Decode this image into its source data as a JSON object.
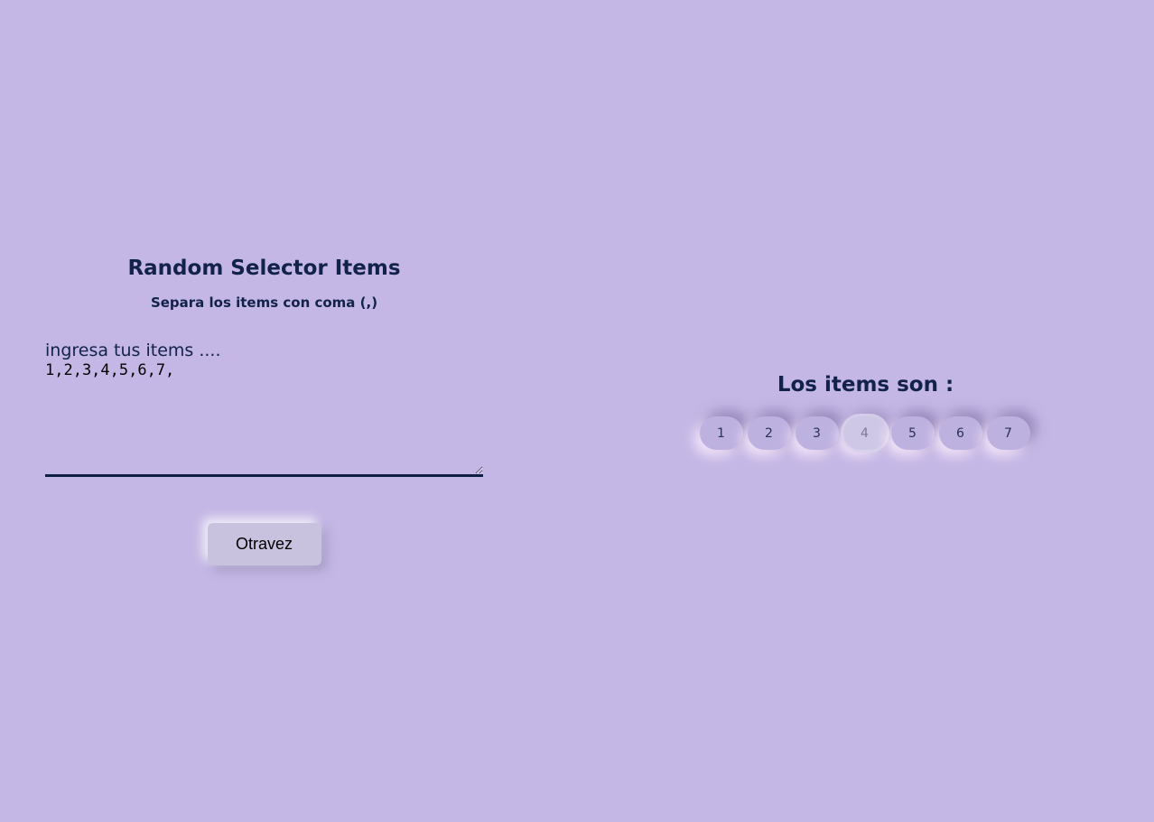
{
  "app": {
    "title": "Random Selector Items",
    "subtitle": "Separa los items con coma (,)"
  },
  "input": {
    "label": "ingresa tus items ....",
    "value": "1,2,3,4,5,6,7,"
  },
  "button": {
    "label": "Otravez"
  },
  "results": {
    "title": "Los items son :",
    "items": [
      "1",
      "2",
      "3",
      "4",
      "5",
      "6",
      "7"
    ],
    "selected": "4"
  },
  "colors": {
    "background": "#c4b7e5",
    "text": "#12224a",
    "chip": "#bdb1e0",
    "chip_selected": "#cfc7e6"
  }
}
